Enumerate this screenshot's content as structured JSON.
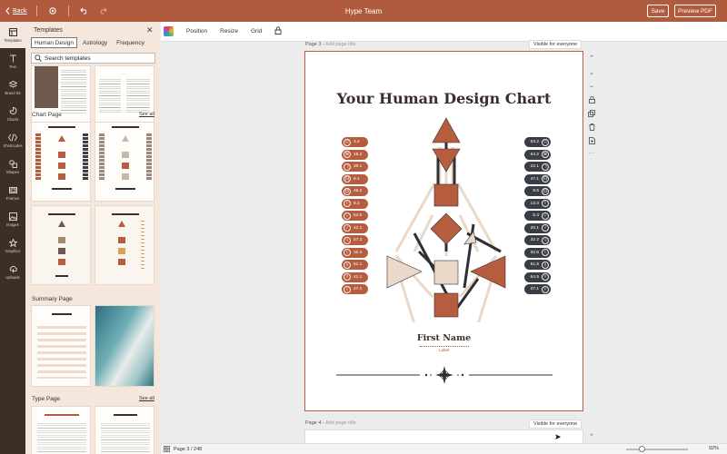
{
  "topbar": {
    "back_label": "Back",
    "title": "Hype Team",
    "save_label": "Save",
    "pdf_label": "Preview PDF"
  },
  "rail": [
    {
      "label": "Templates",
      "icon": "templates-icon"
    },
    {
      "label": "Text",
      "icon": "text-icon"
    },
    {
      "label": "Brand Kit",
      "icon": "brand-kit-icon"
    },
    {
      "label": "Charts",
      "icon": "charts-icon"
    },
    {
      "label": "Shortcodes",
      "icon": "shortcodes-icon"
    },
    {
      "label": "Shapes",
      "icon": "shapes-icon"
    },
    {
      "label": "Frames",
      "icon": "frames-icon"
    },
    {
      "label": "Images",
      "icon": "images-icon"
    },
    {
      "label": "Graphics",
      "icon": "graphics-icon"
    },
    {
      "label": "Uploads",
      "icon": "uploads-icon"
    }
  ],
  "panel": {
    "title": "Templates",
    "tabs": [
      "Human Design",
      "Astrology",
      "Frequency"
    ],
    "search_placeholder": "Search templates",
    "sections": [
      {
        "title": "Chart Page",
        "see_all": "See all"
      },
      {
        "title": "Summary Page"
      },
      {
        "title": "Type Page",
        "see_all": "See all"
      }
    ]
  },
  "toolbar": {
    "position": "Position",
    "resize": "Resize",
    "grid": "Grid"
  },
  "page3": {
    "label": "Page 3 -",
    "add_title": "Add page title",
    "visibility": "Visible for everyone",
    "title": "Your Human Design Chart",
    "name": "First Name",
    "name_label": "Label",
    "left_values": [
      "3.4",
      "15.4",
      "38.1",
      "6.1",
      "46.2",
      "9.2",
      "54.5",
      "42.1",
      "57.3",
      "32.4",
      "51.1",
      "41.1",
      "27.1"
    ],
    "right_values": [
      "63.2",
      "64.2",
      "22.1",
      "47.1",
      "9.5",
      "13.3",
      "5.3",
      "20.1",
      "32.2",
      "32.6",
      "51.5",
      "64.5",
      "37.1"
    ]
  },
  "page4": {
    "label": "Page 4 -",
    "add_title": "Add page title",
    "visibility": "Visible for everyone"
  },
  "bottombar": {
    "pages": "Page 3 / 248",
    "zoom": "92%",
    "zoom_level": 0.25
  },
  "colors": {
    "brand": "#b15b3e",
    "rail": "#3d2e26",
    "panel": "#f5e7dc",
    "dark_pill": "#3a3d45"
  }
}
